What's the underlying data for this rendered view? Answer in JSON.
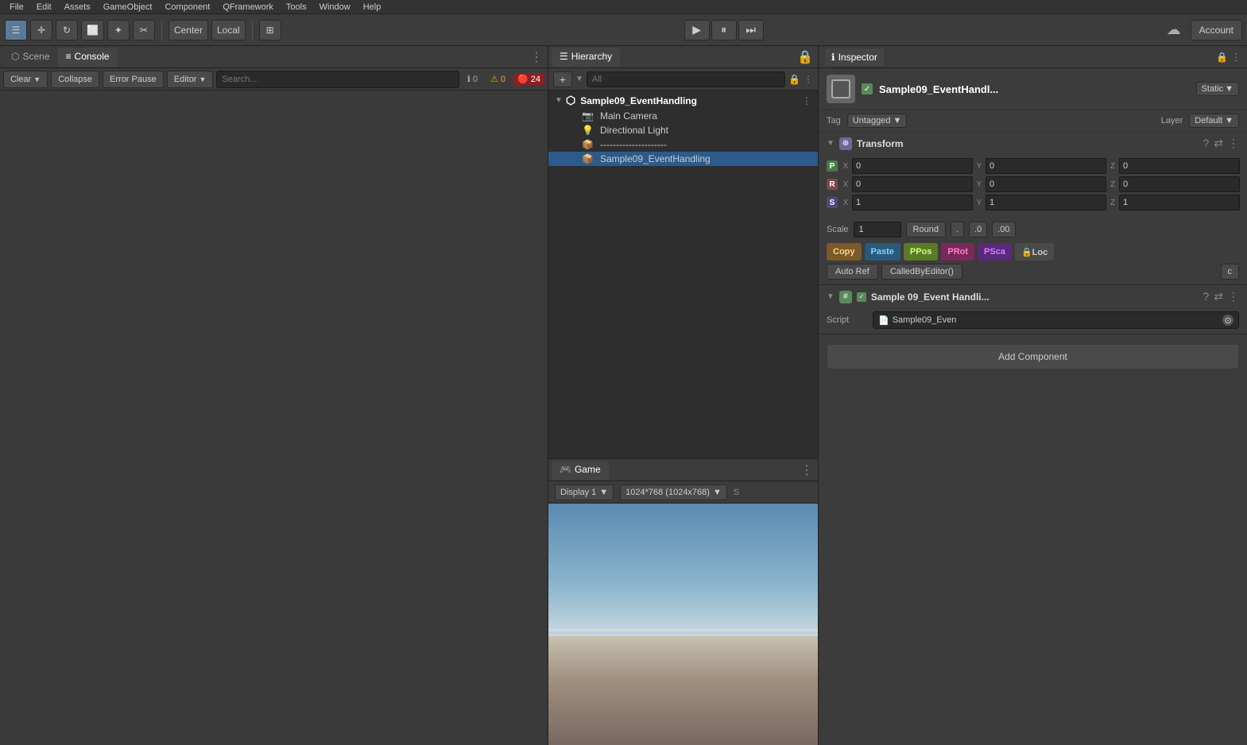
{
  "menubar": {
    "items": [
      "File",
      "Edit",
      "Assets",
      "GameObject",
      "Component",
      "QFramework",
      "Tools",
      "Window",
      "Help"
    ]
  },
  "toolbar": {
    "hand_tool": "✋",
    "move_tool": "⊕",
    "rotate_tool": "↺",
    "rect_tool": "▭",
    "transform_tool": "✦",
    "custom_tool": "✂",
    "center_label": "Center",
    "local_label": "Local",
    "grid_label": "⊞",
    "play_label": "▶",
    "pause_label": "⏸",
    "step_label": "⏭",
    "account_label": "Account",
    "cloud_label": "☁"
  },
  "scene_panel": {
    "tab_scene": "Scene",
    "tab_console": "Console",
    "console_clear": "Clear",
    "console_collapse": "Collapse",
    "console_error_pause": "Error Pause",
    "console_editor": "Editor",
    "console_search_placeholder": "Search...",
    "badge_info_count": "0",
    "badge_warn_count": "0",
    "badge_error_count": "24"
  },
  "hierarchy_panel": {
    "tab_label": "Hierarchy",
    "search_placeholder": "All",
    "root_node": "Sample09_EventHandling",
    "children": [
      {
        "name": "Main Camera",
        "indent": 1,
        "type": "camera"
      },
      {
        "name": "Directional Light",
        "indent": 1,
        "type": "light"
      },
      {
        "name": "---------------------",
        "indent": 1,
        "type": "separator"
      },
      {
        "name": "Sample09_EventHandling",
        "indent": 1,
        "type": "object",
        "selected": true
      }
    ]
  },
  "game_panel": {
    "tab_label": "Game",
    "display_label": "Display 1",
    "resolution_label": "1024*768 (1024x768)",
    "extra_label": "S"
  },
  "inspector": {
    "tab_label": "Inspector",
    "go_name": "Sample09_EventHandl...",
    "go_name_full": "Sample09_EventHandling",
    "static_label": "Static",
    "tag_label": "Tag",
    "tag_value": "Untagged",
    "layer_label": "Layer",
    "layer_value": "Default",
    "transform": {
      "label": "Transform",
      "pos_label": "P",
      "rot_label": "R",
      "scale_label": "S",
      "x0": "0",
      "y0": "0",
      "z0": "0",
      "x1": "0",
      "y1": "0",
      "z1": "0",
      "x2": "1",
      "y2": "1",
      "z2": "1",
      "scale_row_label": "Scale",
      "scale_value": "1",
      "round_label": "Round",
      "dot_label": ".",
      "zero1_label": ".0",
      "zero2_label": ".00",
      "copy_label": "Copy",
      "paste_label": "Paste",
      "ppos_label": "PPos",
      "prot_label": "PRot",
      "psca_label": "PSca",
      "loc_label": "🔒Loc",
      "autoref_label": "Auto Ref",
      "calledby_label": "CalledByEditor()",
      "c_label": "c"
    },
    "script_component": {
      "label": "Sample 09_Event Handli...",
      "script_field_label": "Script",
      "script_value": "Sample09_Even",
      "info_icon": "?"
    },
    "add_component_label": "Add Component"
  }
}
